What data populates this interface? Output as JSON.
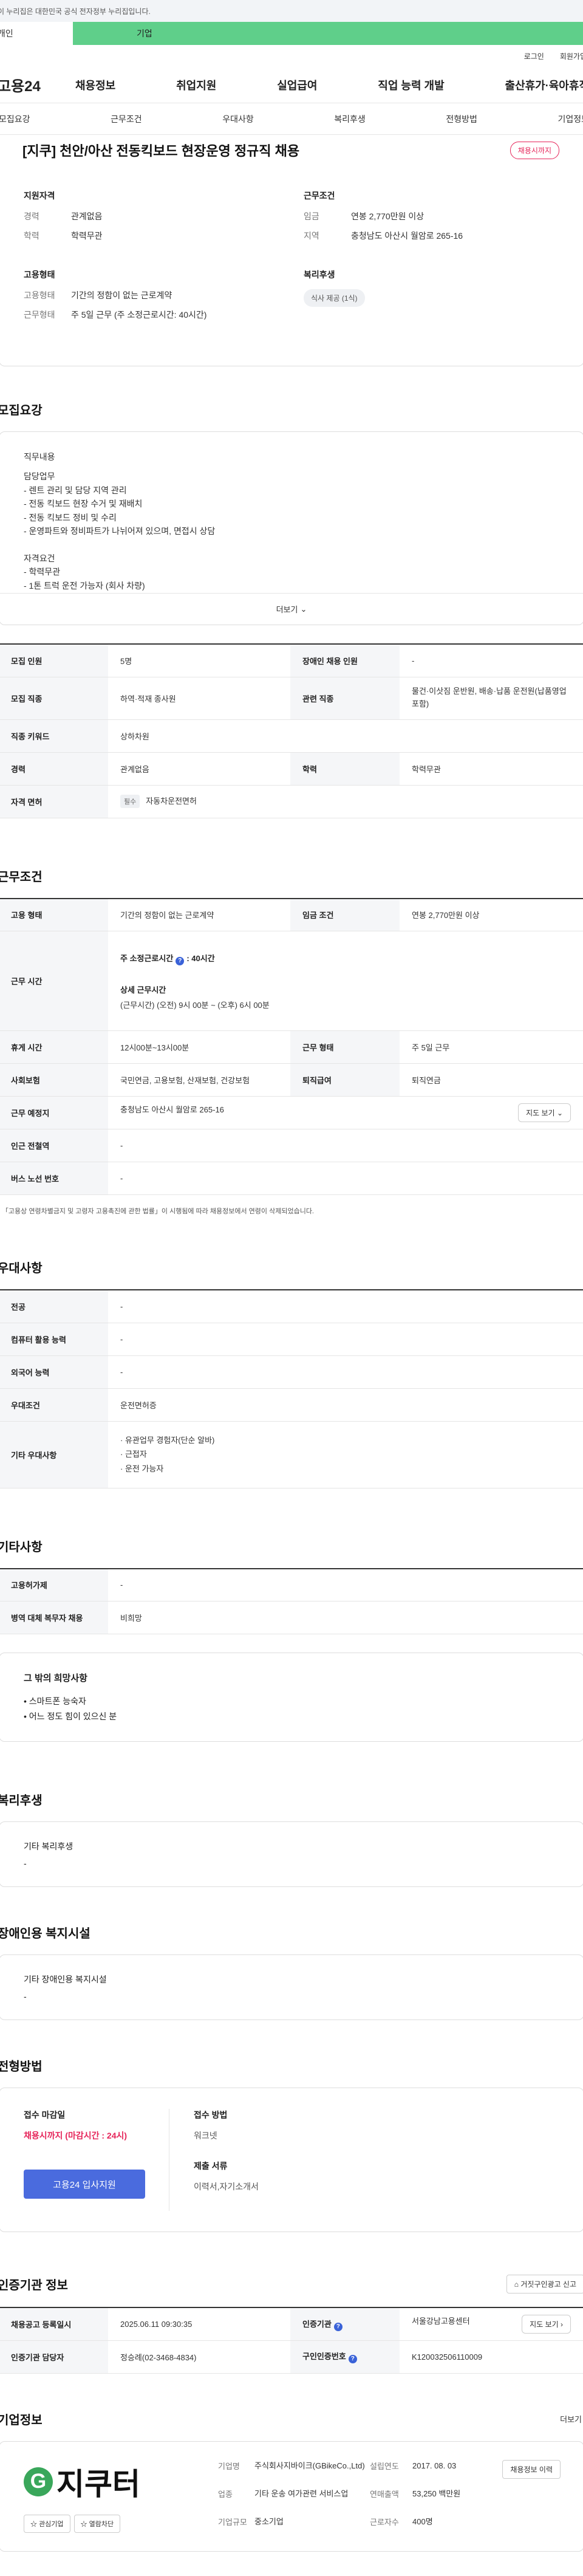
{
  "gov_banner": "이 누리집은 대한민국 공식 전자정부 누리집입니다.",
  "user_tabs": {
    "individual": "개인",
    "corporate": "기업"
  },
  "util_links": [
    "로그인",
    "회원가입"
  ],
  "logo": "고용24",
  "gnb": [
    "채용정보",
    "취업지원",
    "실업급여",
    "직업 능력 개발",
    "출산휴가·육아휴직"
  ],
  "sub_tabs": [
    "모집요강",
    "근무조건",
    "우대사항",
    "복리후생",
    "전형방법",
    "기업정보"
  ],
  "summary": {
    "title": "[지쿠] 천안/아산 전동킥보드 현장운영 정규직 채용",
    "status": "채용시까지",
    "qualification": {
      "heading": "지원자격",
      "career_k": "경력",
      "career_v": "관계없음",
      "edu_k": "학력",
      "edu_v": "학력무관"
    },
    "conditions": {
      "heading": "근무조건",
      "wage_k": "임금",
      "wage_v": "연봉 2,770만원 이상",
      "area_k": "지역",
      "area_v": "충청남도 아산시 월암로 265-16"
    },
    "employment": {
      "heading": "고용형태",
      "type_k": "고용형태",
      "type_v": "기간의 정함이 없는 근로계약",
      "work_k": "근무형태",
      "work_v": "주 5일 근무 (주 소정근로시간: 40시간)"
    },
    "welfare": {
      "heading": "복리후생",
      "chip": "식사 제공 (1식)"
    }
  },
  "recruit": {
    "title": "모집요강",
    "duty_heading": "직무내용",
    "duty_text": "담당업무\n- 렌트 관리 및 담당 지역 관리\n- 전동 킥보드 현장 수거 및 재배치\n- 전동 킥보드 정비 및 수리\n- 운영파트와 정비파트가 나뉘어져 있으며, 면접시 상담\n\n자격요건\n- 학력무관\n- 1톤 트럭 운전 가능자 (회사 차량)",
    "more": "더보기",
    "rows": [
      {
        "k1": "모집 인원",
        "v1": "5명",
        "k2": "장애인 채용 인원",
        "v2": "-"
      },
      {
        "k1": "모집 직종",
        "v1": "하역·적재 종사원",
        "k2": "관련 직종",
        "v2": "물건·이삿짐 운반원, 배송·납품 운전원(납품영업 포함)"
      },
      {
        "k1": "직종 키워드",
        "v1": "상하차원"
      },
      {
        "k1": "경력",
        "v1": "관계없음",
        "k2": "학력",
        "v2": "학력무관"
      },
      {
        "k1": "자격 면허",
        "tag": "필수",
        "v1": "자동차운전면허"
      }
    ]
  },
  "work": {
    "title": "근무조건",
    "type_k": "고용 형태",
    "type_v": "기간의 정함이 없는 근로계약",
    "wage_k": "임금 조건",
    "wage_v": "연봉 2,770만원 이상",
    "hours_k": "근무 시간",
    "hours_week_label": "주 소정근로시간",
    "hours_week_val": ": 40시간",
    "hours_detail_label": "상세 근무시간",
    "hours_detail_val": "(근무시간) (오전) 9시 00분 ~ (오후) 6시 00분",
    "rest_k": "휴게 시간",
    "rest_v": "12시00분~13시00분",
    "form_k": "근무 형태",
    "form_v": "주 5일 근무",
    "insure_k": "사회보험",
    "insure_v": "국민연금, 고용보험, 산재보험, 건강보험",
    "retire_k": "퇴직급여",
    "retire_v": "퇴직연금",
    "place_k": "근무 예정지",
    "place_v": "충청남도 아산시 월암로 265-16",
    "map_btn": "지도 보기",
    "subway_k": "인근 전철역",
    "subway_v": "-",
    "bus_k": "버스 노선 번호",
    "bus_v": "-",
    "note": "「고용상 연령차별금지 및 고령자 고용촉진에 관한 법률」이 시행됨에 따라 채용정보에서 연령이 삭제되었습니다."
  },
  "prefer": {
    "title": "우대사항",
    "rows": [
      {
        "k": "전공",
        "v": "-"
      },
      {
        "k": "컴퓨터 활용 능력",
        "v": "-"
      },
      {
        "k": "외국어 능력",
        "v": "-"
      },
      {
        "k": "우대조건",
        "v": "운전면허증"
      }
    ],
    "etc_k": "기타 우대사항",
    "etc_list": [
      "· 유관업무 경험자(단순 알바)",
      "· 근접자",
      "· 운전 가능자"
    ]
  },
  "others": {
    "title": "기타사항",
    "rows": [
      {
        "k": "고용허가제",
        "v": "-"
      },
      {
        "k": "병역 대체 복무자 채용",
        "v": "비희망"
      }
    ],
    "hope_title": "그 밖의 희망사항",
    "hope_list": [
      "• 스마트폰 능숙자",
      "• 어느 정도 힘이 있으신 분"
    ]
  },
  "benefit": {
    "title": "복리후생",
    "heading": "기타 복리후생",
    "value": "-"
  },
  "disability": {
    "title": "장애인용 복지시설",
    "heading": "기타 장애인용 복지시설",
    "value": "-"
  },
  "screening": {
    "title": "전형방법",
    "deadline_heading": "접수 마감일",
    "deadline_value": "채용시까지 (마감시간 : 24시)",
    "apply_btn": "고용24 입사지원",
    "method_heading": "접수 방법",
    "method_value": "워크넷",
    "docs_heading": "제출 서류",
    "docs_value": "이력서,자기소개서"
  },
  "agency": {
    "title": "인증기관 정보",
    "report_btn": "거짓구인광고 신고",
    "reg_k": "채용공고 등록일시",
    "reg_v": "2025.06.11 09:30:35",
    "org_k": "인증기관",
    "org_v": "서울강남고용센터",
    "map_btn": "지도 보기",
    "manager_k": "인증기관 담당자",
    "manager_v": "정승례(02-3468-4834)",
    "num_k": "구인인증번호",
    "num_v": "K120032506110009"
  },
  "company": {
    "title": "기업정보",
    "more": "더보기",
    "logo_text": "지쿠터",
    "logo_mark": "G",
    "btn_interest": "관심기업",
    "btn_favorite": "열람차단",
    "name_k": "기업명",
    "name_v": "주식회사지바이크(GBikeCo.,Ltd)",
    "founded_k": "설립연도",
    "founded_v": "2017. 08. 03",
    "industry_k": "업종",
    "industry_v": "기타 운송 여가관련 서비스업",
    "sales_k": "연매출액",
    "sales_v": "53,250 백만원",
    "size_k": "기업규모",
    "size_v": "중소기업",
    "staff_k": "근로자수",
    "staff_v": "400명",
    "jobs_btn": "채용정보 이력"
  }
}
